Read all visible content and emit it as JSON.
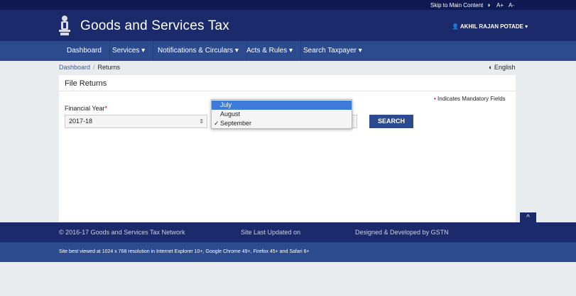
{
  "topbar": {
    "skip_link": "Skip to Main Content",
    "contrast_icon": "◑",
    "font_increase": "A+",
    "font_decrease": "A-"
  },
  "header": {
    "title": "Goods and Services Tax",
    "user": "👤 AKHIL RAJAN POTADE ▾"
  },
  "nav": {
    "items": [
      "Dashboard",
      "Services ▾",
      "Notifications & Circulars ▾",
      "Acts & Rules ▾",
      "Search Taxpayer ▾"
    ]
  },
  "breadcrumb": {
    "home": "Dashboard",
    "current": "Returns"
  },
  "language": "◐ English",
  "panel": {
    "title": "File Returns",
    "mandatory_marker": "•",
    "mandatory_text": " Indicates Mandatory Fields",
    "financial_year_label": "Financial Year",
    "required_star": "*",
    "financial_year_value": "2017-18",
    "select_arrows": "⇕",
    "search_label": "SEARCH"
  },
  "dropdown": {
    "options": [
      "July",
      "August",
      "September"
    ],
    "highlighted": "July",
    "selected": "September",
    "check": "✓"
  },
  "scroll_top": "^",
  "footer": {
    "copyright": "© 2016-17 Goods and Services Tax Network",
    "updated": "Site Last Updated on",
    "designed": "Designed & Developed by GSTN",
    "browser_note": "Site best viewed at 1024 x 768 resolution in Internet Explorer 10+, Google Chrome 49+, Firefox 45+ and Safari 6+"
  },
  "colors": {
    "header": "#1b2a6b",
    "nav": "#2c4a8e",
    "highlight": "#3d7bd9",
    "required": "#d0021b"
  }
}
